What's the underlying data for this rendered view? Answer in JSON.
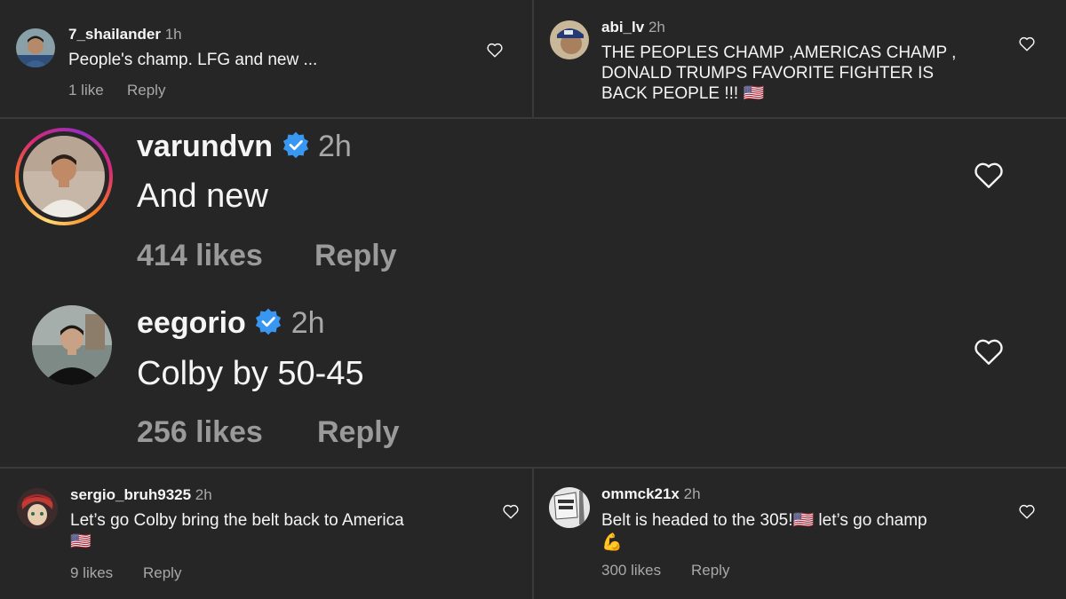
{
  "comments": [
    {
      "username": "7_shailander",
      "time": "1h",
      "text_lines": [
        "People's champ. LFG and new ..."
      ],
      "likes": "1 like",
      "reply": "Reply"
    },
    {
      "username": "abi_lv",
      "time": "2h",
      "text_lines": [
        "THE PEOPLES CHAMP ,AMERICAS CHAMP ,",
        "DONALD TRUMPS FAVORITE FIGHTER IS",
        "BACK PEOPLE !!! 🇺🇸"
      ]
    },
    {
      "username": "varundvn",
      "verified": true,
      "time": "2h",
      "text_lines": [
        "And new"
      ],
      "likes": "414 likes",
      "reply": "Reply"
    },
    {
      "username": "eegorio",
      "verified": true,
      "time": "2h",
      "text_lines": [
        "Colby by 50-45"
      ],
      "likes": "256 likes",
      "reply": "Reply"
    },
    {
      "username": "sergio_bruh9325",
      "time": "2h",
      "text_lines": [
        "Let’s go Colby bring the belt back to America",
        "🇺🇸"
      ],
      "likes": "9 likes",
      "reply": "Reply"
    },
    {
      "username": "ommck21x",
      "time": "2h",
      "text_lines": [
        "Belt is headed to the 305!🇺🇸  let’s go champ",
        "💪"
      ],
      "likes": "300 likes",
      "reply": "Reply"
    }
  ],
  "icons": {
    "like": "heart-outline-icon",
    "verified": "verified-badge-icon"
  },
  "colors": {
    "background": "#262626",
    "text": "#f5f5f5",
    "secondary_text": "#a8a8a8",
    "verified_blue": "#3897f0"
  }
}
